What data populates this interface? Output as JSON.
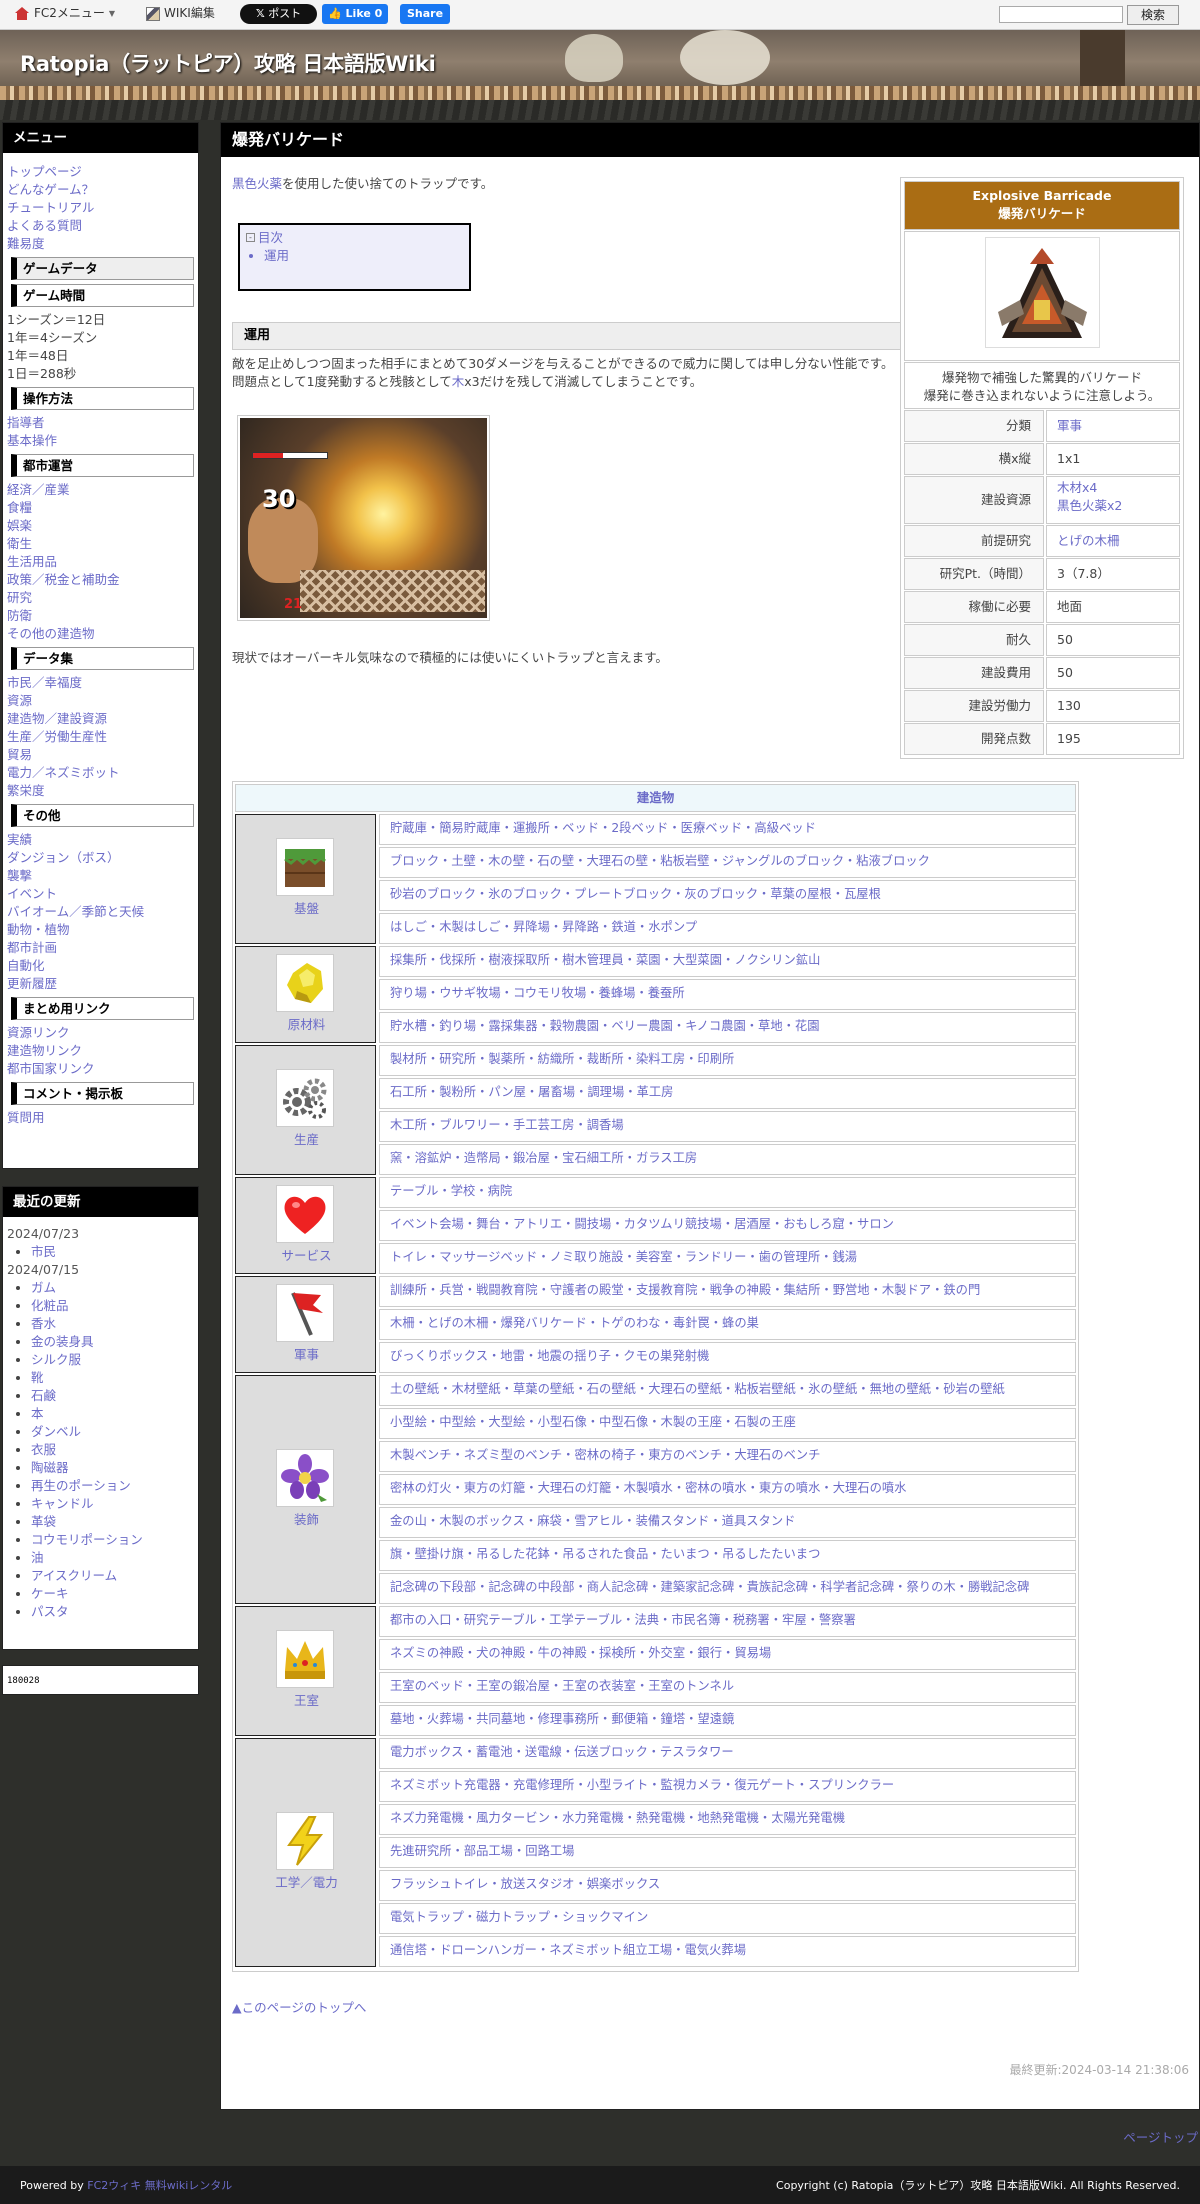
{
  "topbar": {
    "fc2_menu": "FC2メニュー",
    "wiki_edit": "WIKI編集",
    "x_post": "ポスト",
    "fb_like": "Like 0",
    "fb_share": "Share",
    "search_button": "検索"
  },
  "site_title": "Ratopia（ラットピア）攻略 日本語版Wiki",
  "sidebar": {
    "menu_title": "メニュー",
    "menu_links": [
      "トップページ",
      "どんなゲーム？",
      "チュートリアル",
      "よくある質問",
      "難易度"
    ],
    "game_data": "ゲームデータ",
    "game_time": "ゲーム時間",
    "time_lines": [
      "1シーズン＝12日",
      "1年＝4シーズン",
      "1年＝48日",
      "1日＝288秒"
    ],
    "controls": "操作方法",
    "controls_links": [
      "指導者",
      "基本操作"
    ],
    "city": "都市運営",
    "city_links": [
      "経済／産業",
      "食糧",
      "娯楽",
      "衛生",
      "生活用品",
      "政策／税金と補助金",
      "研究",
      "防衛",
      "その他の建造物"
    ],
    "data": "データ集",
    "data_links": [
      "市民／幸福度",
      "資源",
      "建造物／建設資源",
      "生産／労働生産性",
      "貿易",
      "電力／ネズミボット",
      "繁栄度"
    ],
    "other": "その他",
    "other_links": [
      "実績",
      "ダンジョン（ボス）",
      "襲撃",
      "イベント",
      "バイオーム／季節と天候",
      "動物・植物",
      "都市計画",
      "自動化",
      "更新履歴"
    ],
    "summary": "まとめ用リンク",
    "summary_links": [
      "資源リンク",
      "建造物リンク",
      "都市国家リンク"
    ],
    "comment": "コメント・掲示板",
    "comment_links": [
      "質問用"
    ],
    "updates_title": "最近の更新",
    "updates": [
      {
        "date": "2024/07/23",
        "items": [
          "市民"
        ]
      },
      {
        "date": "2024/07/15",
        "items": [
          "ガム",
          "化粧品",
          "香水",
          "金の装身具",
          "シルク服",
          "靴",
          "石鹸",
          "本",
          "ダンベル",
          "衣服",
          "陶磁器",
          "再生のポーション",
          "キャンドル",
          "革袋",
          "コウモリポーション",
          "油",
          "アイスクリーム",
          "ケーキ",
          "パスタ"
        ]
      }
    ],
    "counter": "180028"
  },
  "page": {
    "title": "爆発バリケード",
    "intro_link": "黒色火薬",
    "intro_rest": "を使用した使い捨てのトラップです。",
    "toc_label": "目次",
    "toc_items": [
      "運用"
    ],
    "section": "運用",
    "para1": "敵を足止めしつつ固まった相手にまとめて30ダメージを与えることができるので威力に関しては申し分ない性能です。",
    "para2a": "問題点として1度発動すると残骸として",
    "para2link": "木",
    "para2b": "x3だけを残して消滅してしまうことです。",
    "shot_damage": "30",
    "shot_num2": "21",
    "para3": "現状ではオーバーキル気味なので積極的には使いにくいトラップと言えます。",
    "top_link": "▲このページのトップへ",
    "last_modified": "最終更新:2024-03-14 21:38:06",
    "page_top": "ページトップ"
  },
  "infobox": {
    "name_en": "Explosive Barricade",
    "name_ja": "爆発バリケード",
    "desc1": "爆発物で補強した驚異的バリケード",
    "desc2": "爆発に巻き込まれないように注意しよう。",
    "rows": [
      {
        "k": "分類",
        "v": "軍事",
        "link": true
      },
      {
        "k": "横x縦",
        "v": "1x1",
        "link": false
      },
      {
        "k": "前提研究",
        "v": "とげの木柵",
        "link": true
      },
      {
        "k": "研究Pt.（時間）",
        "v": "3（7.8）",
        "link": false
      },
      {
        "k": "稼働に必要",
        "v": "地面",
        "link": false
      },
      {
        "k": "耐久",
        "v": "50",
        "link": false
      },
      {
        "k": "建設費用",
        "v": "50",
        "link": false
      },
      {
        "k": "建設労働力",
        "v": "130",
        "link": false
      },
      {
        "k": "開発点数",
        "v": "195",
        "link": false
      }
    ],
    "res_label": "建設資源",
    "res_1": "木材x4",
    "res_2": "黒色火薬x2"
  },
  "nav": {
    "header": "建造物",
    "groups": [
      {
        "label": "基盤",
        "icon": "crate-icon",
        "rows": [
          "貯蔵庫・簡易貯蔵庫・運搬所・ベッド・2段ベッド・医療ベッド・高級ベッド",
          "ブロック・土壁・木の壁・石の壁・大理石の壁・粘板岩壁・ジャングルのブロック・粘液ブロック",
          "砂岩のブロック・氷のブロック・プレートブロック・灰のブロック・草葉の屋根・瓦屋根",
          "はしご・木製はしご・昇降場・昇降路・鉄道・水ポンプ"
        ]
      },
      {
        "label": "原材料",
        "icon": "ore-icon",
        "rows": [
          "採集所・伐採所・樹液採取所・樹木管理員・菜園・大型菜園・ノクシリン鉱山",
          "狩り場・ウサギ牧場・コウモリ牧場・養蜂場・養蚕所",
          "貯水槽・釣り場・露採集器・穀物農園・ベリー農園・キノコ農園・草地・花園"
        ]
      },
      {
        "label": "生産",
        "icon": "gears-icon",
        "rows": [
          "製材所・研究所・製薬所・紡織所・裁断所・染料工房・印刷所",
          "石工所・製粉所・パン屋・屠畜場・調理場・革工房",
          "木工所・ブルワリー・手工芸工房・調香場",
          "窯・溶鉱炉・造幣局・鍛冶屋・宝石細工所・ガラス工房"
        ]
      },
      {
        "label": "サービス",
        "icon": "heart-icon",
        "rows": [
          "テーブル・学校・病院",
          "イベント会場・舞台・アトリエ・闘技場・カタツムリ競技場・居酒屋・おもしろ窟・サロン",
          "トイレ・マッサージベッド・ノミ取り施設・美容室・ランドリー・歯の管理所・銭湯"
        ]
      },
      {
        "label": "軍事",
        "icon": "flag-icon",
        "rows": [
          "訓練所・兵営・戦闘教育院・守護者の殿堂・支援教育院・戦争の神殿・集結所・野営地・木製ドア・鉄の門",
          "木柵・とげの木柵・爆発バリケード・トゲのわな・毒針罠・蜂の巣",
          "びっくりボックス・地雷・地震の揺り子・クモの巣発射機"
        ]
      },
      {
        "label": "装飾",
        "icon": "flower-icon",
        "rows": [
          "土の壁紙・木材壁紙・草葉の壁紙・石の壁紙・大理石の壁紙・粘板岩壁紙・氷の壁紙・無地の壁紙・砂岩の壁紙",
          "小型絵・中型絵・大型絵・小型石像・中型石像・木製の王座・石製の王座",
          "木製ベンチ・ネズミ型のベンチ・密林の椅子・東方のベンチ・大理石のベンチ",
          "密林の灯火・東方の灯籠・大理石の灯籠・木製噴水・密林の噴水・東方の噴水・大理石の噴水",
          "金の山・木製のボックス・麻袋・雪アヒル・装備スタンド・道具スタンド",
          "旗・壁掛け旗・吊るした花鉢・吊るされた食品・たいまつ・吊るしたたいまつ",
          "記念碑の下段部・記念碑の中段部・商人記念碑・建築家記念碑・貴族記念碑・科学者記念碑・祭りの木・勝戦記念碑"
        ]
      },
      {
        "label": "王室",
        "icon": "crown-icon",
        "rows": [
          "都市の入口・研究テーブル・工学テーブル・法典・市民名簿・税務署・牢屋・警察署",
          "ネズミの神殿・犬の神殿・牛の神殿・採検所・外交室・銀行・貿易場",
          "王室のベッド・王室の鍛冶屋・王室の衣装室・王室のトンネル",
          "墓地・火葬場・共同墓地・修理事務所・郵便箱・鐘塔・望遠鏡"
        ]
      },
      {
        "label": "工学／電力",
        "icon": "lightning-icon",
        "rows": [
          "電力ボックス・蓄電池・送電線・伝送ブロック・テスラタワー",
          "ネズミボット充電器・充電修理所・小型ライト・監視カメラ・復元ゲート・スプリンクラー",
          "ネズ力発電機・風力タービン・水力発電機・熱発電機・地熱発電機・太陽光発電機",
          "先進研究所・部品工場・回路工場",
          "フラッシュトイレ・放送スタジオ・娯楽ボックス",
          "電気トラップ・磁力トラップ・ショックマイン",
          "通信塔・ドローンハンガー・ネズミボット組立工場・電気火葬場"
        ]
      }
    ]
  },
  "footer": {
    "powered_prefix": "Powered by ",
    "powered_link": "FC2ウィキ 無料wikiレンタル",
    "copyright": "Copyright (c) Ratopia（ラットピア）攻略 日本語版Wiki. All Rights Reserved."
  }
}
